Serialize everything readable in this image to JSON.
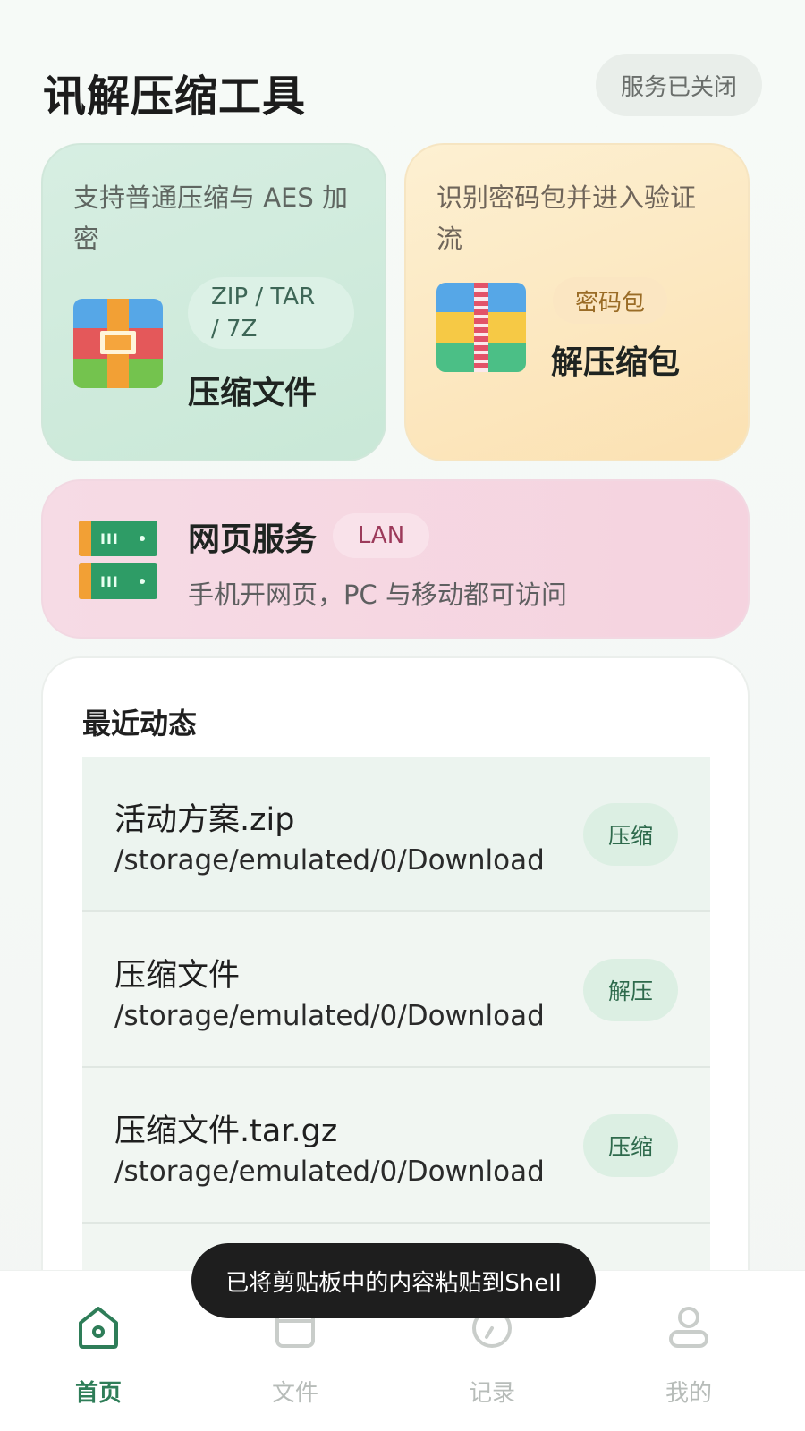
{
  "header": {
    "app_title": "讯解压缩工具",
    "service_status": "服务已关闭"
  },
  "cards": {
    "compress": {
      "description": "支持普通压缩与 AES 加密",
      "formats": "ZIP / TAR / 7Z",
      "title": "压缩文件",
      "icon": "archive-box-icon"
    },
    "decompress": {
      "description": "识别密码包并进入验证流",
      "tag": "密码包",
      "title": "解压缩包",
      "icon": "zipped-package-icon"
    },
    "web": {
      "title": "网页服务",
      "tag": "LAN",
      "subtitle": "手机开网页，PC 与移动都可访问",
      "icon": "server-icon"
    }
  },
  "recent": {
    "title": "最近动态",
    "items": [
      {
        "name": "活动方案.zip",
        "path": "/storage/emulated/0/Download",
        "action": "压缩"
      },
      {
        "name": "压缩文件",
        "path": "/storage/emulated/0/Download",
        "action": "解压"
      },
      {
        "name": "压缩文件.tar.gz",
        "path": "/storage/emulated/0/Download",
        "action": "压缩"
      }
    ]
  },
  "toast": "已将剪贴板中的内容粘贴到Shell",
  "nav": {
    "items": [
      {
        "label": "首页",
        "icon": "home-icon",
        "active": true
      },
      {
        "label": "文件",
        "icon": "folder-icon",
        "active": false
      },
      {
        "label": "记录",
        "icon": "clock-icon",
        "active": false
      },
      {
        "label": "我的",
        "icon": "user-icon",
        "active": false
      }
    ]
  },
  "colors": {
    "accent": "#2e7d58",
    "compress_card": "#d0ebdc",
    "decompress_card": "#fbe7c0",
    "web_card": "#f5d6e1",
    "toast_bg": "#1e1e1e"
  }
}
